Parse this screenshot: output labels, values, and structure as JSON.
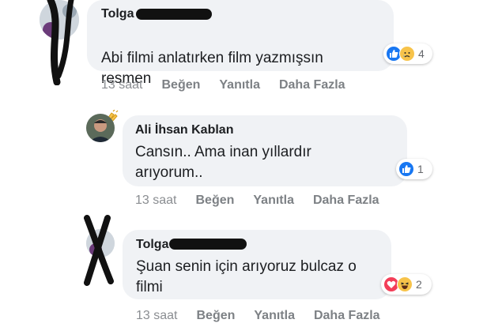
{
  "comments": [
    {
      "author": "Tolga",
      "text": "Abi filmi anlatırken film yazmışsın\nresmen",
      "reaction_icons": [
        "like-icon",
        "sad-icon"
      ],
      "reaction_count": "4",
      "time": "13 saat",
      "actions": [
        "Beğen",
        "Yanıtla",
        "Daha Fazla"
      ]
    },
    {
      "author": "Ali İhsan Kablan",
      "text": "Cansın.. Ama inan yıllardır\narıyorum..",
      "reaction_icons": [
        "like-icon"
      ],
      "reaction_count": "1",
      "time": "13 saat",
      "actions": [
        "Beğen",
        "Yanıtla",
        "Daha Fazla"
      ]
    },
    {
      "author": "Tolga",
      "text": "Şuan senin için arıyoruz bulcaz o\nfilmi",
      "reaction_icons": [
        "love-icon",
        "haha-icon"
      ],
      "reaction_count": "2",
      "time": "13 saat",
      "actions": [
        "Beğen",
        "Yanıtla",
        "Daha Fazla"
      ]
    }
  ],
  "colors": {
    "bubble": "#f0f2f5",
    "like": "#1877f2",
    "love": "#f33e58",
    "emoji": "#f7c34a",
    "meta_text": "#8a8d91"
  }
}
